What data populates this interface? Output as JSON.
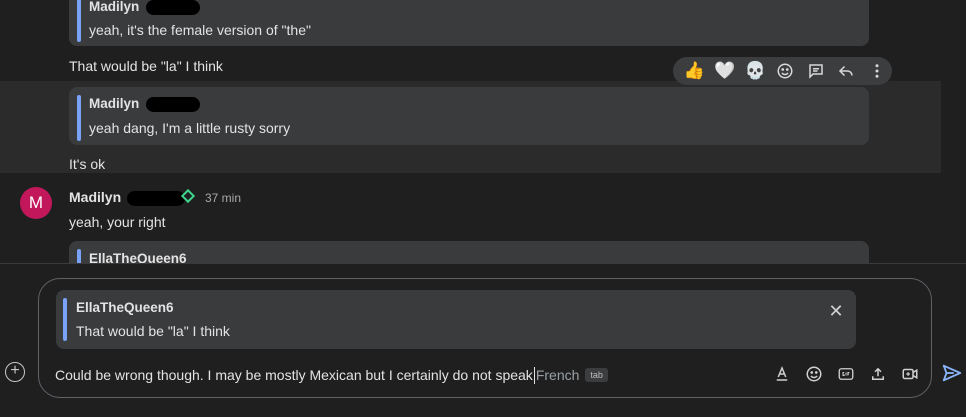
{
  "messages": {
    "quote1": {
      "name": "Madilyn",
      "text": "yeah, it's the female version of \"the\""
    },
    "msg1": "That would be \"la\" I think",
    "quote2": {
      "name": "Madilyn",
      "text": "yeah dang, I'm a little rusty sorry"
    },
    "msg2": "It's ok",
    "sender": {
      "initial": "M",
      "name": "Madilyn",
      "time": "37 min"
    },
    "msg3": "yeah, your right",
    "quote3": {
      "name": "EllaTheQueen6"
    }
  },
  "reactions": [
    "thumbs-up-icon",
    "heart-icon",
    "skull-icon",
    "emoji-icon",
    "reply-in-thread-icon",
    "reply-icon",
    "more-vert-icon"
  ],
  "reply_preview": {
    "name": "EllaTheQueen6",
    "text": "That would be \"la\" I think",
    "close": "✕"
  },
  "composer": {
    "typed": "Could be wrong though. I may be mostly Mexican but I certainly do not speak",
    "suggestion": "French",
    "tab_hint": "tab",
    "add_symbol": "+"
  },
  "colors": {
    "accent": "#7aa2f7",
    "avatar": "#c2185b",
    "online": "#3dd68c"
  }
}
